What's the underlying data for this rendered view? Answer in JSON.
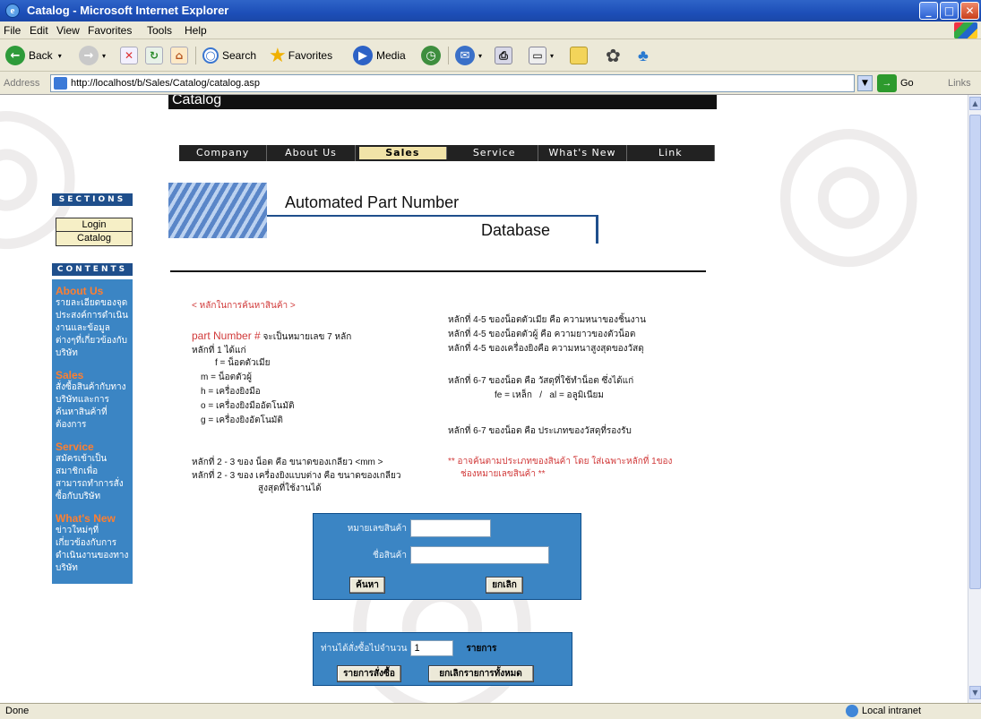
{
  "window": {
    "title": "Catalog - Microsoft Internet Explorer"
  },
  "menu": [
    "File",
    "Edit",
    "View",
    "Favorites",
    "Tools",
    "Help"
  ],
  "toolbar": {
    "back": "Back",
    "search": "Search",
    "favorites": "Favorites",
    "media": "Media"
  },
  "address": {
    "label": "Address",
    "url": "http://localhost/b/Sales/Catalog/catalog.asp",
    "go": "Go",
    "links": "Links"
  },
  "status": {
    "text": "Done",
    "zone": "Local intranet"
  },
  "page": {
    "header": "Catalog",
    "nav": [
      {
        "label": "Company",
        "active": false
      },
      {
        "label": "About Us",
        "active": false
      },
      {
        "label": "Sales",
        "active": true
      },
      {
        "label": "Service",
        "active": false
      },
      {
        "label": "What's New",
        "active": false
      },
      {
        "label": "Link",
        "active": false
      }
    ],
    "banner": {
      "line1": "Automated Part Number",
      "line2": "Database"
    },
    "sections": {
      "heading": "SECTIONS",
      "links": [
        "Login",
        "Catalog"
      ]
    },
    "contents": {
      "heading": "CONTENTS",
      "items": [
        {
          "title": "About Us",
          "desc": "รายละเอียดของจุดประสงค์การดำเนินงานและข้อมูลต่างๆที่เกี่ยวข้องกับบริษัท"
        },
        {
          "title": "Sales",
          "desc": "สั่งซื้อสินค้ากับทางบริษัทและการค้นหาสินค้าที่ต้องการ"
        },
        {
          "title": "Service",
          "desc": "สมัครเข้าเป็นสมาชิกเพื่อสามารถทำการสั่งซื้อกับบริษัท"
        },
        {
          "title": "What's New",
          "desc": "ข่าวใหม่ๆที่เกี่ยวข้องกับการดำเนินงานของทางบริษัท"
        }
      ]
    },
    "info": {
      "heading": "< หลักในการค้นหาสินค้า >",
      "part_label": "part Number #",
      "part_rest": "จะเป็นหมายเลข 7 หลัก",
      "digit1": "หลักที่ 1 ได้แก่",
      "d1_items": [
        "f = น็อตตัวเมีย",
        "m = น็อตตัวผู้",
        "h = เครื่องยิงมือ",
        "o = เครื่องยิงมืออัตโนมัติ",
        "g = เครื่องยิงอัตโนมัติ"
      ],
      "digit23_a": "หลักที่ 2 - 3 ของ น็อต คือ ขนาดของเกลียว <mm >",
      "digit23_b": "หลักที่ 2 - 3 ของ เครื่องยิงแบบต่าง คือ ขนาดของเกลียว",
      "digit23_c": "สูงสุดที่ใช้งานได้",
      "digit45": [
        "หลักที่ 4-5 ของน็อตตัวเมีย คือ ความหนาของชิ้นงาน",
        "หลักที่ 4-5 ของน็อตตัวผู้ คือ ความยาวของตัวน็อต",
        "หลักที่ 4-5 ของเครื่องยิงคือ ความหนาสูงสุดของวัสดุ"
      ],
      "digit67_a": "หลักที่ 6-7 ของน็อต คือ วัสดุที่ใช้ทำน็อต ซึ่งได้แก่",
      "digit67_mat": "fe = เหล็ก   /   al = อลูมิเนียม",
      "digit67_b": "หลักที่ 6-7 ของน็อต คือ ประเภทของวัสดุที่รองรับ",
      "note_a": "** อาจค้นตามประเภทของสินค้า โดย ใส่เฉพาะหลักที่ 1ของ",
      "note_b": "ช่องหมายเลขสินค้า **"
    },
    "search": {
      "code_label": "หมายเลขสินค้า",
      "code_value": "",
      "name_label": "ชื่อสินค้า",
      "name_value": "",
      "search_btn": "ค้นหา",
      "cancel_btn": "ยกเลิก"
    },
    "cart": {
      "label": "ท่านได้สั่งซื้อไปจำนวน",
      "count": "1",
      "unit": "รายการ",
      "list_btn": "รายการสั่งซื้อ",
      "cancel_all_btn": "ยกเลิกรายการทั้งหมด"
    }
  }
}
